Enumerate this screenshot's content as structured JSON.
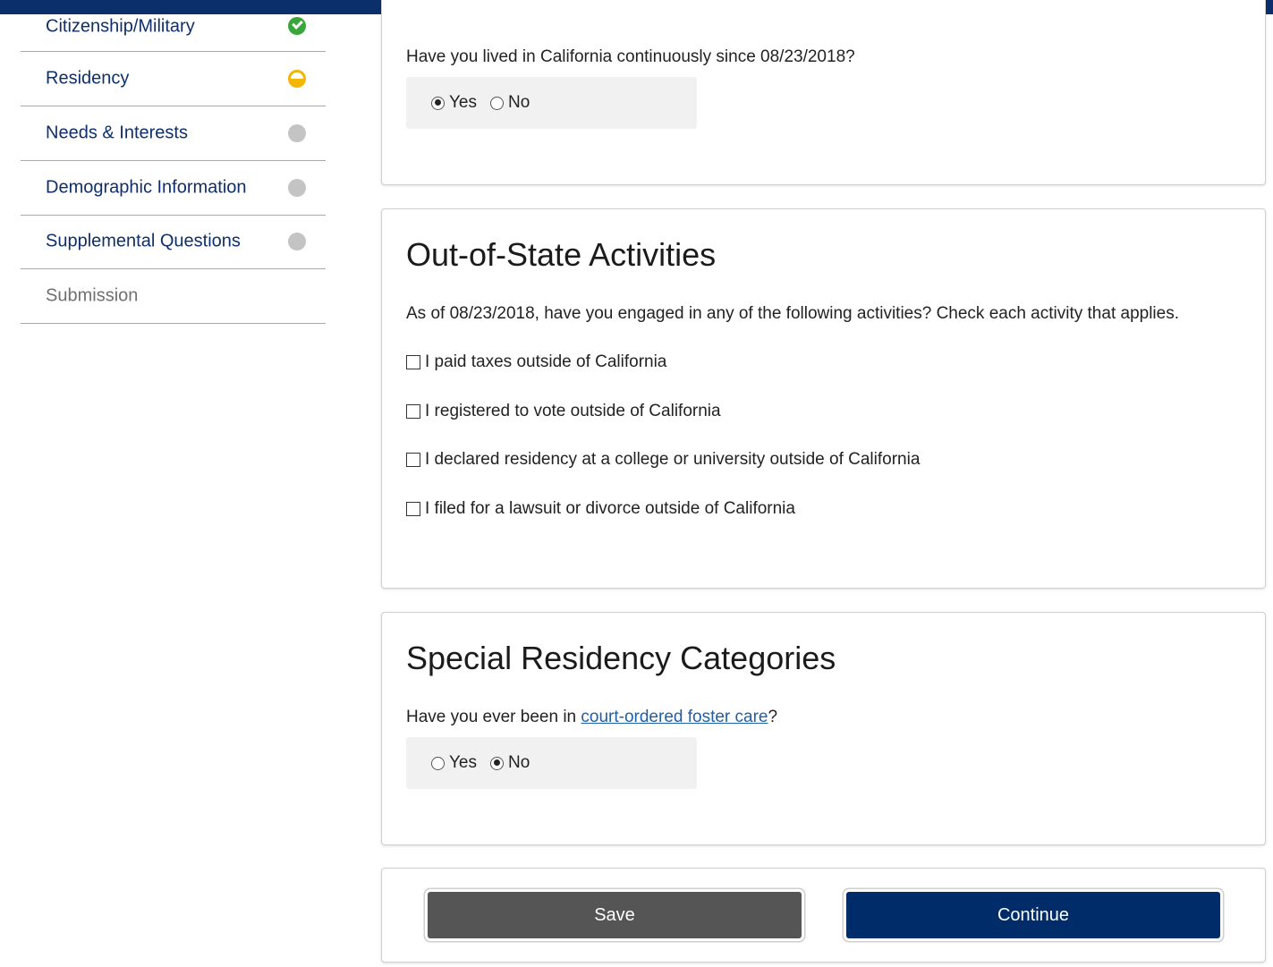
{
  "sidebar": {
    "items": [
      {
        "label": "Citizenship/Military",
        "status": "complete"
      },
      {
        "label": "Residency",
        "status": "in-progress"
      },
      {
        "label": "Needs & Interests",
        "status": "not-started"
      },
      {
        "label": "Demographic Information",
        "status": "not-started"
      },
      {
        "label": "Supplemental Questions",
        "status": "not-started"
      },
      {
        "label": "Submission",
        "status": "disabled"
      }
    ]
  },
  "residency_card": {
    "question": "Have you lived in California continuously since 08/23/2018?",
    "yes_label": "Yes",
    "no_label": "No",
    "selected": "Yes"
  },
  "out_of_state": {
    "title": "Out-of-State Activities",
    "prompt": "As of 08/23/2018, have you engaged in any of the following activities? Check each activity that applies.",
    "options": [
      {
        "label": "I paid taxes outside of California",
        "checked": false
      },
      {
        "label": "I registered to vote outside of California",
        "checked": false
      },
      {
        "label": "I declared residency at a college or university outside of California",
        "checked": false
      },
      {
        "label": "I filed for a lawsuit or divorce outside of California",
        "checked": false
      }
    ]
  },
  "special": {
    "title": "Special Residency Categories",
    "question_prefix": "Have you ever been in",
    "link_text": "court-ordered foster care",
    "question_suffix": "?",
    "yes_label": "Yes",
    "no_label": "No",
    "selected": "No"
  },
  "actions": {
    "save_label": "Save",
    "continue_label": "Continue"
  },
  "colors": {
    "header": "#0a2f6b",
    "nav_text": "#0f2f6a",
    "complete": "#3aa63a",
    "in_progress": "#f2b705",
    "not_started": "#c4c4c4",
    "continue_button": "#002d6a",
    "save_button": "#555555"
  }
}
